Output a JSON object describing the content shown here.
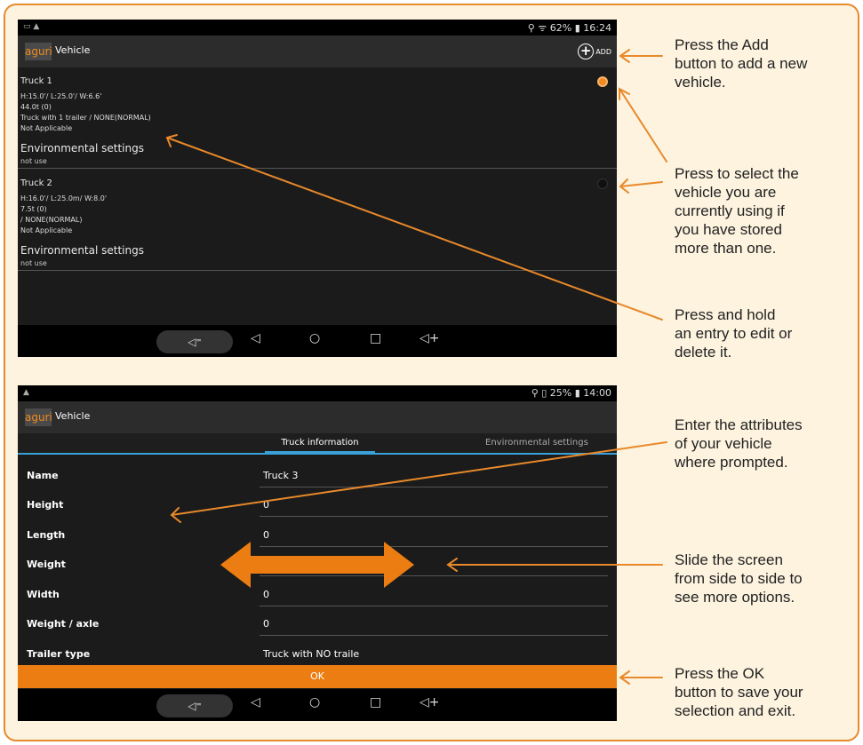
{
  "screen1": {
    "status": {
      "left": "▭ ▲",
      "right": "⚲ ᯤ 62% ▮ 16:24"
    },
    "app": {
      "logo": "aguri",
      "title": "Vehicle",
      "add_label": "ADD"
    },
    "vehicles": [
      {
        "name": "Truck 1",
        "dims": "H:15.0'/ L:25.0'/ W:6.6'",
        "weight": "44.0t (0)",
        "trailer": "Truck with 1 trailer / NONE(NORMAL)",
        "status": "Not Applicable",
        "env_title": "Environmental settings",
        "env_value": "not use",
        "selected": true
      },
      {
        "name": "Truck 2",
        "dims": "H:16.0'/ L:25.0m/ W:8.0'",
        "weight": "7.5t (0)",
        "trailer": "/ NONE(NORMAL)",
        "status": "Not Applicable",
        "env_title": "Environmental settings",
        "env_value": "not use",
        "selected": false
      }
    ]
  },
  "screen2": {
    "status": {
      "left": "▲",
      "right": "⚲ ▯ 25% ▮ 14:00"
    },
    "app": {
      "logo": "aguri",
      "title": "Vehicle"
    },
    "tabs": {
      "tab1": "Truck information",
      "tab2": "Environmental settings"
    },
    "fields": [
      {
        "label": "Name",
        "value": "Truck 3"
      },
      {
        "label": "Height",
        "value": "0"
      },
      {
        "label": "Length",
        "value": "0"
      },
      {
        "label": "Weight",
        "value": ""
      },
      {
        "label": "Width",
        "value": "0"
      },
      {
        "label": "Weight / axle",
        "value": "0"
      },
      {
        "label": "Trailer type",
        "value": "Truck with NO traile"
      }
    ],
    "ok_label": "OK"
  },
  "navbar": {
    "volume_down": "◁⁼",
    "back": "◁",
    "home": "○",
    "recent": "□",
    "volume_up": "◁+"
  },
  "notes": {
    "add": [
      "Press the Add",
      "button to add a new",
      "vehicle."
    ],
    "select": [
      "Press to select the",
      "vehicle you are",
      "currently using if",
      "you have stored",
      "more than one."
    ],
    "hold": [
      "Press and hold",
      "an entry to edit or",
      "delete it."
    ],
    "attributes": [
      "Enter the attributes",
      "of your vehicle",
      "where prompted."
    ],
    "slide": [
      "Slide the screen",
      "from side to side to",
      "see more options."
    ],
    "ok": [
      "Press the OK",
      "button to save your",
      "selection and exit."
    ]
  },
  "colors": {
    "accent": "#ec7d12",
    "frame_bg": "#fdf3df",
    "tab_underline": "#3aa0d8"
  }
}
